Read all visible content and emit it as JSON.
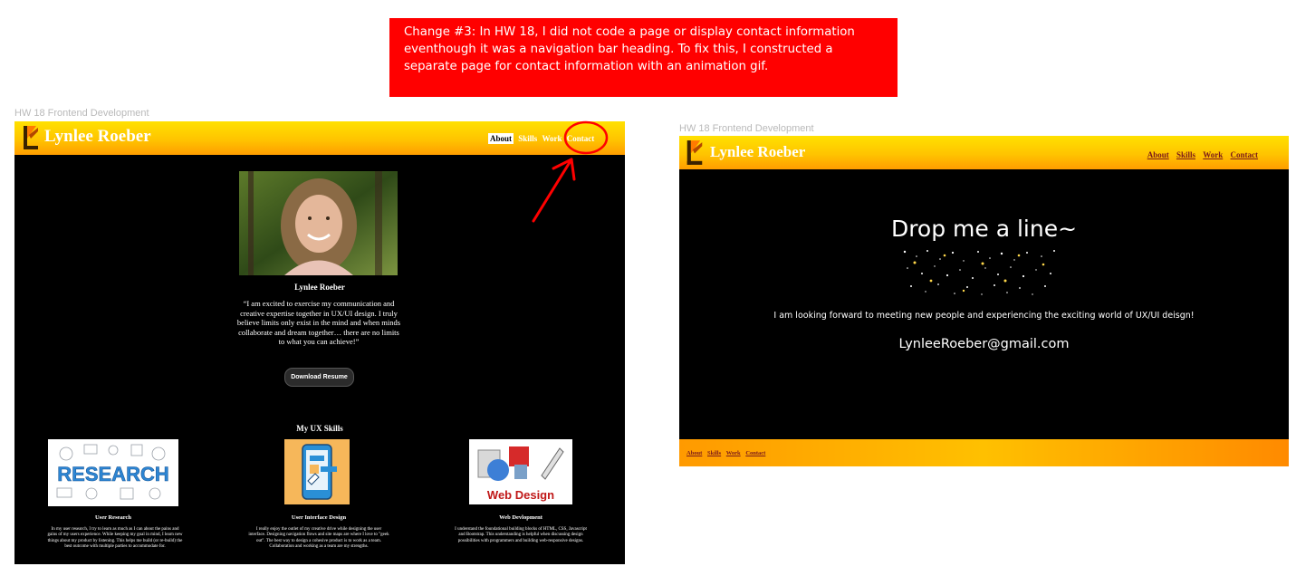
{
  "annotation": {
    "lines": [
      "Change #3: In HW 18, I did not code a page or display contact information",
      "eventhough it was a navigation bar heading. To fix this, I constructed a",
      "separate page for contact information with an animation gif."
    ]
  },
  "frames": {
    "left_label": "HW 18 Frontend Development",
    "right_label": "HW 18 Frontend Development"
  },
  "left_page": {
    "brand": "Lynlee Roeber",
    "nav": [
      "About",
      "Skills",
      "Work",
      "Contact"
    ],
    "profile_name": "Lynlee Roeber",
    "quote": "“I am excited to exercise my communication and creative expertise together in UX/UI design. I truly believe limits only exist in the mind and when minds collaborate and dream together… there are no limits to what you can achieve!”",
    "download_button": "Download Resume",
    "skills_title": "My UX Skills",
    "skills": [
      {
        "image_text": "RESEARCH",
        "title": "User Research",
        "text": "In my user research, I try to learn as much as I can about the pains and gains of my users experience. While keeping my goal in mind, I learn new things about my product by listening. This helps me build (or re-build) the best outcome with multiple parties to accommodate for."
      },
      {
        "image_text": "",
        "title": "User Interface Design",
        "text": "I really enjoy the outlet of my creative drive while designing the user interface. Designing navigation flows and site maps are where I love to \"geek out\". The best way to design a cohesive product is to work as a team. Collaboration and working as a team are my strengths."
      },
      {
        "image_text": "Web Design",
        "title": "Web Devlopment",
        "text": "I understand the foundational building blocks of HTML, CSS, Javascript and Bootstrap. This understanding is helpful when discussing design possibilities with programmers and building web-responsive designs."
      }
    ]
  },
  "right_page": {
    "brand": "Lynlee Roeber",
    "nav": [
      "About",
      "Skills",
      "Work",
      "Contact"
    ],
    "heading": "Drop me a line~",
    "message": "I am looking forward to meeting new people and experiencing the exciting world of UX/UI deisgn!",
    "email": "LynleeRoeber@gmail.com",
    "footer_nav": [
      "About",
      "Skills",
      "Work",
      "Contact"
    ]
  },
  "colors": {
    "annotation_bg": "#ff0000",
    "header_gradient_top": "#ffe100",
    "header_gradient_bottom": "#ff9d00",
    "highlight_circle": "#ff0000",
    "nav_link_dark": "#7b1a1a"
  },
  "icons": [
    "logo-l-icon",
    "red-arrow-annotation",
    "red-circle-annotation"
  ]
}
